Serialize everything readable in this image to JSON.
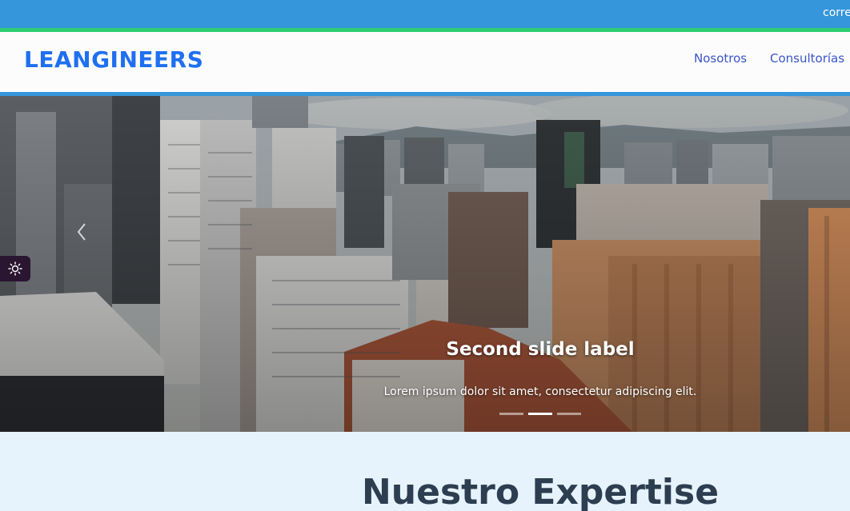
{
  "topbar": {
    "text": "corre"
  },
  "navbar": {
    "brand": "LEANGINEERS",
    "links": [
      {
        "label": "Nosotros"
      },
      {
        "label": "Consultorías"
      }
    ]
  },
  "carousel": {
    "caption_title": "Second slide label",
    "caption_text": "Lorem ipsum dolor sit amet, consectetur adipiscing elit.",
    "active_slide": 2,
    "slide_count": 3,
    "icons": {
      "prev": "chevron-left-icon",
      "theme": "sun-icon"
    }
  },
  "expertise": {
    "title": "Nuestro Expertise"
  },
  "colors": {
    "topbar": "#3596db",
    "accent_line": "#2ecc71",
    "brand": "#1f6ff1",
    "nav_link": "#3a55c9",
    "section_bg": "#e6f3fd",
    "heading": "#2c3e50"
  }
}
